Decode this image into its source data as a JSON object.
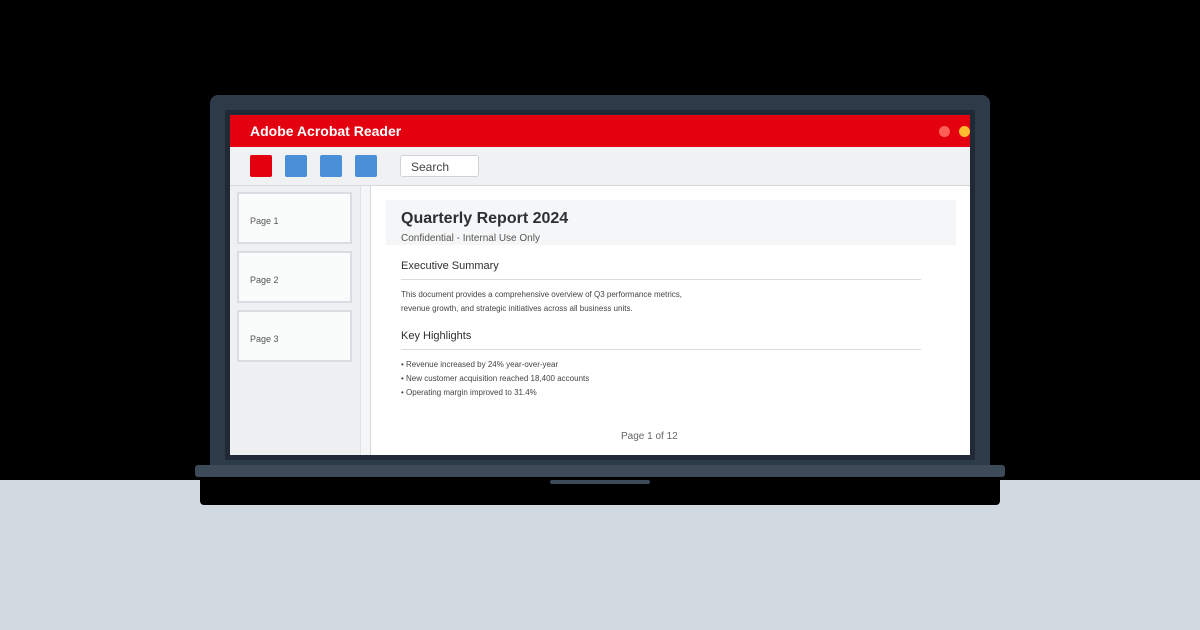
{
  "app": {
    "title": "Adobe Acrobat Reader",
    "window_controls": [
      "close",
      "minimize",
      "maximize"
    ]
  },
  "toolbar": {
    "tools": [
      "red-tool-icon",
      "blue-tool-icon",
      "blue-tool-icon",
      "blue-tool-icon"
    ],
    "search_label": "Search"
  },
  "sidebar": {
    "pages": [
      {
        "label": "Page 1"
      },
      {
        "label": "Page 2"
      },
      {
        "label": "Page 3"
      }
    ]
  },
  "document": {
    "title": "Quarterly Report 2024",
    "subtitle": "Confidential - Internal Use Only",
    "sections": [
      {
        "heading": "Executive Summary",
        "lines": [
          "This document provides a comprehensive overview of Q3 performance metrics,",
          "revenue growth, and strategic initiatives across all business units."
        ]
      },
      {
        "heading": "Key Highlights",
        "bullets": [
          "• Revenue increased by 24% year-over-year",
          "• New customer acquisition reached 18,400 accounts",
          "• Operating margin improved to 31.4%"
        ]
      }
    ],
    "page_counter": "Page 1 of 12"
  },
  "colors": {
    "brand_red": "#e3000f",
    "tool_blue": "#4a90d9",
    "background": "#000000",
    "desk": "#d1d9e1"
  }
}
